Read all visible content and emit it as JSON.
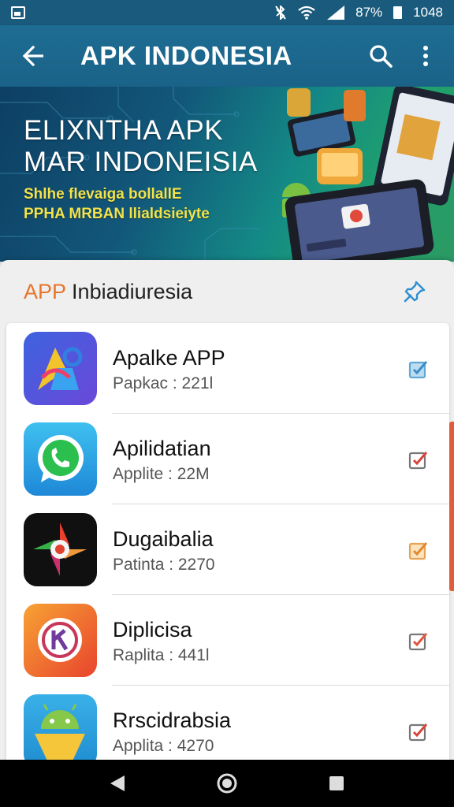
{
  "status_bar": {
    "battery": "87%",
    "time": "1048"
  },
  "app_bar": {
    "title": "APK INDONESIA",
    "icons": [
      "back-arrow-icon",
      "search-icon",
      "more-vert-icon"
    ]
  },
  "banner": {
    "headline_line1": "ELIXNTHA APK",
    "headline_line2": "MAR INDONEISIA",
    "sub_line1": "Shlhe flevaiga bollallE",
    "sub_line2": "PPHA MRBAN llialdsieiyte"
  },
  "section": {
    "title_accent": "APP",
    "title_rest": " Inbiadiuresia",
    "pin_icon": "pin-icon"
  },
  "apps": [
    {
      "name": "Apalke APP",
      "meta": "Papkac : 221l",
      "icon": "shapes-app-icon",
      "check_color": "#5fa9d6"
    },
    {
      "name": "Apilidatian",
      "meta": "Applite : 22M",
      "icon": "whatsapp-icon",
      "check_color": "#d86a5e"
    },
    {
      "name": "Dugaibalia",
      "meta": "Patinta : 2270",
      "icon": "pinwheel-app-icon",
      "check_color": "#e8a353"
    },
    {
      "name": "Diplicisa",
      "meta": "Raplita : 441l",
      "icon": "circle-k-app-icon",
      "check_color": "#e0553f"
    },
    {
      "name": "Rrscidrabsia",
      "meta": "Applita : 4270",
      "icon": "android-app-icon",
      "check_color": "#d86a5e"
    }
  ],
  "colors": {
    "status_bar": "#1a5a7c",
    "app_bar": "#1e6d93",
    "accent": "#e8742a",
    "scroll_indicator": "#e05c3a"
  }
}
